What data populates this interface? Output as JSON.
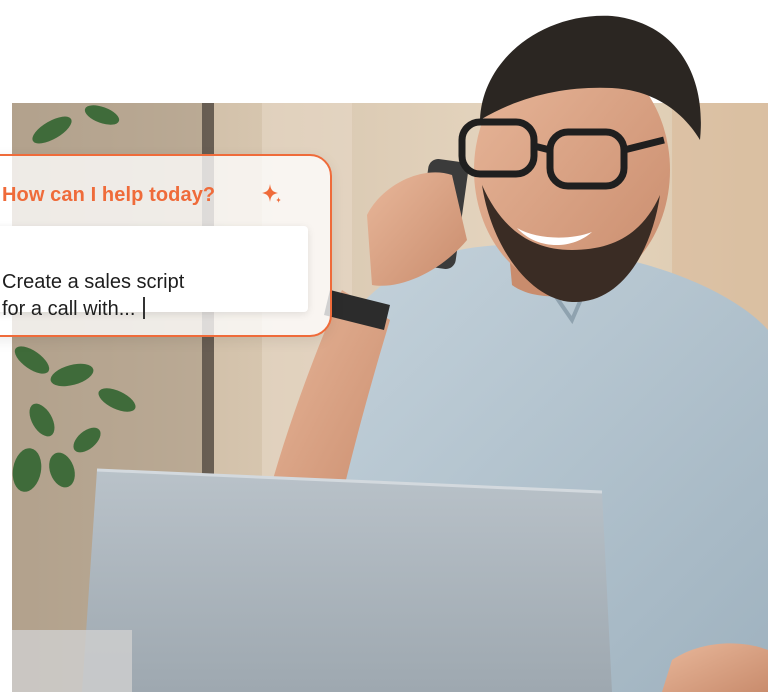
{
  "prompt_card": {
    "title": "How can I help today?",
    "input_value": "Create a sales script\nfor a call with...",
    "icon": "sparkle-icon"
  },
  "colors": {
    "accent": "#ef6b3a",
    "text": "#1e1e1e",
    "background": "#ffffff"
  },
  "photo": {
    "icon": "smiling-man-on-phone-illustration"
  }
}
